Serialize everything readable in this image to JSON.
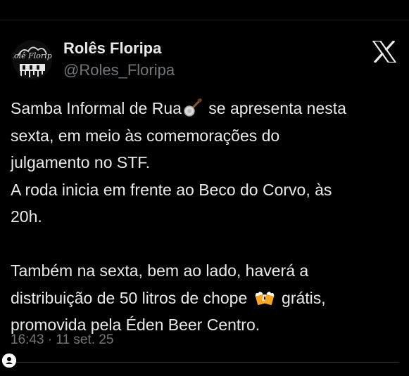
{
  "tweet": {
    "author": {
      "display_name": "Rolês Floripa",
      "handle": "@Roles_Floripa",
      "avatar_text": "Rolê Floripa"
    },
    "platform_icon": "x-logo-icon",
    "lines": [
      {
        "before": "Samba Informal de Rua",
        "emoji": "banjo",
        "after": " se apresenta nesta"
      },
      {
        "text": "sexta, em meio às comemorações do"
      },
      {
        "text": "julgamento no STF."
      },
      {
        "text": "A roda inicia em frente ao Beco do Corvo, às"
      },
      {
        "text": "20h."
      },
      {
        "text": "Também na sexta, bem ao lado, haverá a"
      },
      {
        "before": "distribuição de 50 litros de chope ",
        "emoji": "clinking-beer-mugs",
        "after": " grátis,"
      },
      {
        "text": "promovida pela Éden Beer Centro."
      }
    ],
    "timestamp": "16:43 · 11 set. 25"
  },
  "colors": {
    "background": "#000000",
    "text_primary": "#e7e9ea",
    "text_secondary": "#71767b",
    "divider": "#2f3336"
  }
}
